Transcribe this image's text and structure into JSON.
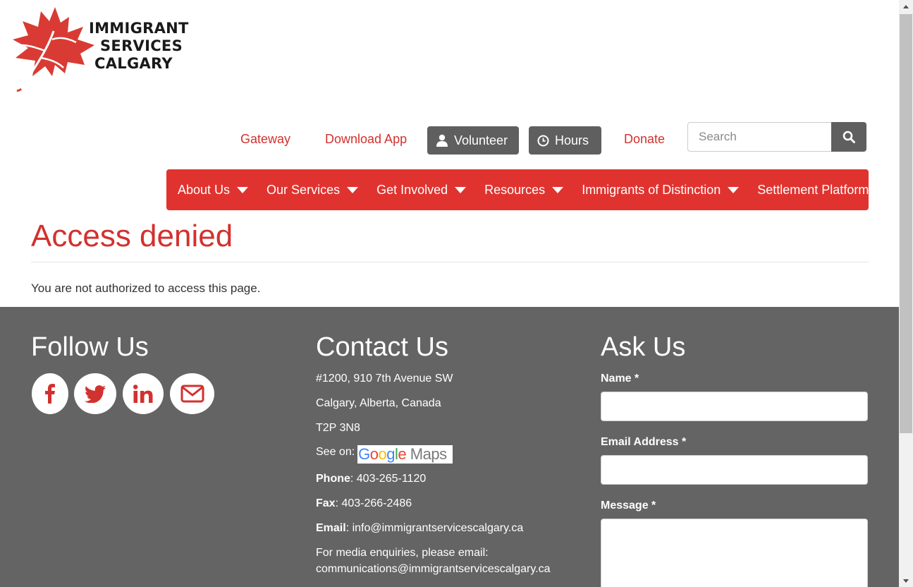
{
  "logo": {
    "line1": "IMMIGRANT",
    "line2": "SERVICES",
    "line3": "CALGARY"
  },
  "toplinks": {
    "gateway": "Gateway",
    "download_app": "Download App",
    "volunteer": "Volunteer",
    "hours": "Hours",
    "donate": "Donate"
  },
  "search": {
    "placeholder": "Search"
  },
  "nav": {
    "about": "About Us",
    "services": "Our Services",
    "involved": "Get Involved",
    "resources": "Resources",
    "distinction": "Immigrants of Distinction",
    "settlement": "Settlement Platform"
  },
  "page": {
    "title": "Access denied",
    "message": "You are not authorized to access this page."
  },
  "footer": {
    "follow": {
      "heading": "Follow Us"
    },
    "contact": {
      "heading": "Contact Us",
      "address1": "#1200, 910 7th Avenue SW",
      "address2": "Calgary, Alberta, Canada",
      "postal": "T2P 3N8",
      "see_on": "See on:",
      "phone_label": "Phone",
      "phone": "403-265-1120",
      "fax_label": "Fax",
      "fax": "403-266-2486",
      "email_label": "Email",
      "email": "info@immigrantservicescalgary.ca",
      "media_line": "For media enquiries, please email:",
      "media_email": "communications@immigrantservicescalgary.ca"
    },
    "ask": {
      "heading": "Ask Us",
      "name_label": "Name *",
      "email_label": "Email Address *",
      "message_label": "Message *"
    }
  },
  "colors": {
    "brand_red": "#e0332f",
    "text_red": "#d2312e",
    "footer_bg": "#646464",
    "button_gray": "#5f5f5f"
  }
}
